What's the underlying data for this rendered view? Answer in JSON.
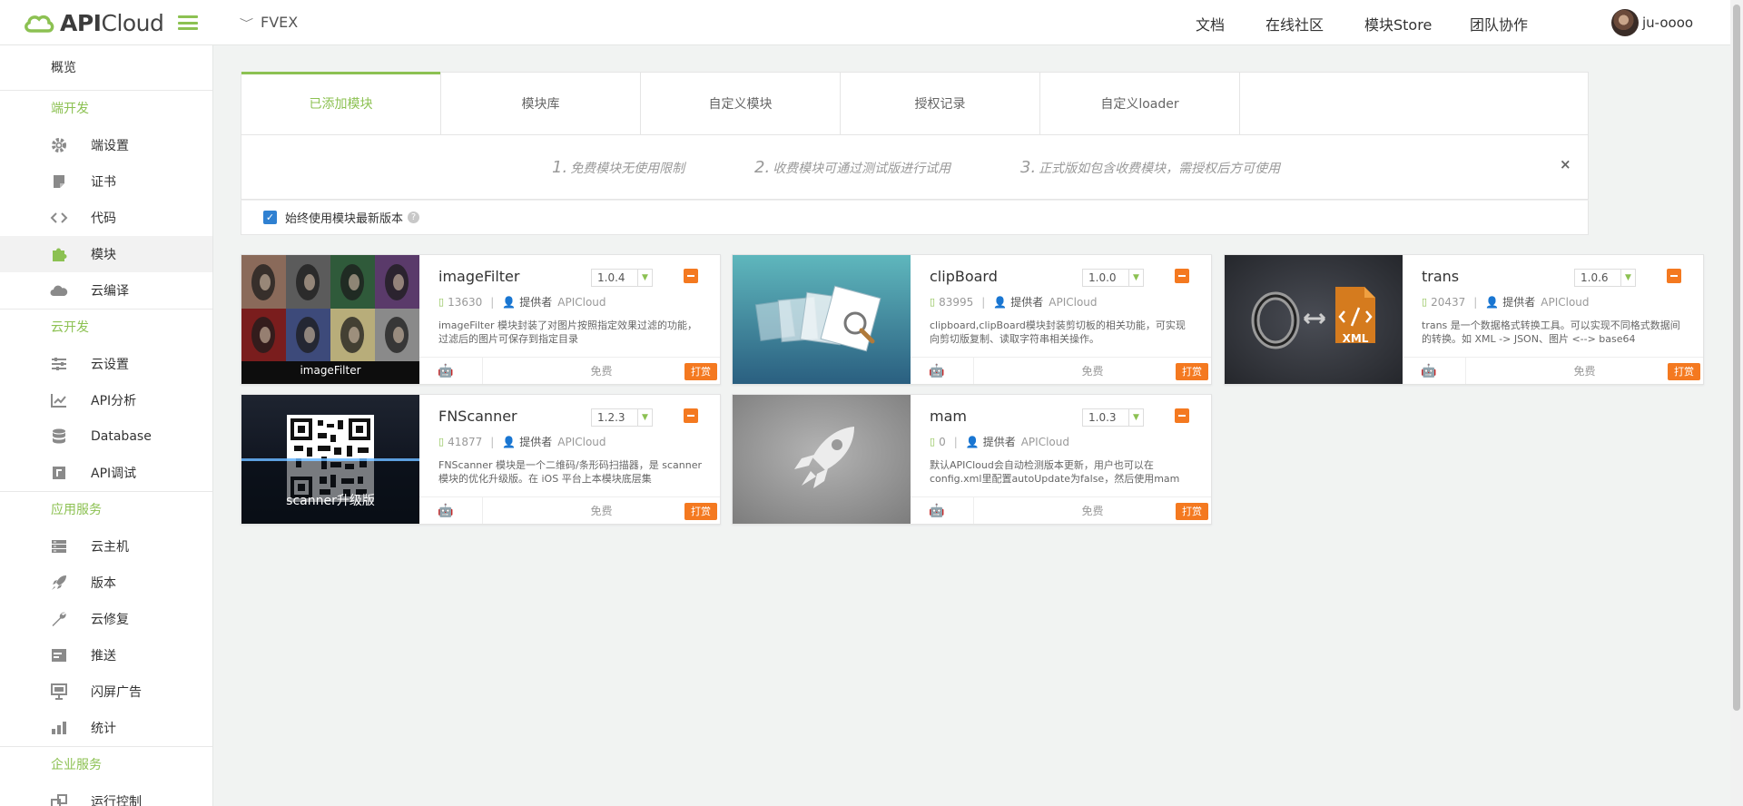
{
  "header": {
    "logo_text": "APICloud",
    "project": "FVEX",
    "nav": [
      "文档",
      "在线社区",
      "模块Store",
      "团队协作"
    ],
    "user": "ju-oooo"
  },
  "sidebar": {
    "overview": "概览",
    "sections": [
      {
        "title": "端开发",
        "items": [
          {
            "label": "端设置",
            "icon": "gear-icon"
          },
          {
            "label": "证书",
            "icon": "certificate-icon"
          },
          {
            "label": "代码",
            "icon": "code-icon"
          },
          {
            "label": "模块",
            "icon": "puzzle-icon"
          },
          {
            "label": "云编译",
            "icon": "cloud-icon"
          }
        ]
      },
      {
        "title": "云开发",
        "items": [
          {
            "label": "云设置",
            "icon": "sliders-icon"
          },
          {
            "label": "API分析",
            "icon": "chart-line-icon"
          },
          {
            "label": "Database",
            "icon": "database-icon"
          },
          {
            "label": "API调试",
            "icon": "debug-icon"
          }
        ]
      },
      {
        "title": "应用服务",
        "items": [
          {
            "label": "云主机",
            "icon": "server-icon"
          },
          {
            "label": "版本",
            "icon": "rocket-icon"
          },
          {
            "label": "云修复",
            "icon": "wrench-icon"
          },
          {
            "label": "推送",
            "icon": "push-icon"
          },
          {
            "label": "闪屏广告",
            "icon": "ad-icon"
          },
          {
            "label": "统计",
            "icon": "bar-chart-icon"
          }
        ]
      },
      {
        "title": "企业服务",
        "items": [
          {
            "label": "运行控制",
            "icon": "control-icon"
          }
        ]
      }
    ]
  },
  "tabs": [
    "已添加模块",
    "模块库",
    "自定义模块",
    "授权记录",
    "自定义loader"
  ],
  "notice": {
    "items": [
      {
        "num": "1.",
        "text": "免费模块无使用限制"
      },
      {
        "num": "2.",
        "text": "收费模块可通过测试版进行试用"
      },
      {
        "num": "3.",
        "text": "正式版如包含收费模块，需授权后方可使用"
      }
    ],
    "close": "×"
  },
  "option": {
    "label": "始终使用模块最新版本",
    "help": "?"
  },
  "modules": [
    {
      "name": "imageFilter",
      "version": "1.0.4",
      "downloads": "13630",
      "provider_label": "提供者",
      "provider": "APICloud",
      "desc": "imageFilter 模块封装了对图片按照指定效果过滤的功能，过滤后的图片可保存到指定目录",
      "price": "免费",
      "reward": "打赏",
      "thumb_caption": "imageFilter"
    },
    {
      "name": "clipBoard",
      "version": "1.0.0",
      "downloads": "83995",
      "provider_label": "提供者",
      "provider": "APICloud",
      "desc": "clipboard,clipBoard模块封装剪切板的相关功能，可实现向剪切版复制、读取字符串相关操作。",
      "price": "免费",
      "reward": "打赏",
      "thumb_caption": ""
    },
    {
      "name": "trans",
      "version": "1.0.6",
      "downloads": "20437",
      "provider_label": "提供者",
      "provider": "APICloud",
      "desc": "trans 是一个数据格式转换工具。可以实现不同格式数据间的转换。如 XML -> JSON、图片 <--> base64",
      "price": "免费",
      "reward": "打赏",
      "thumb_caption": "XML"
    },
    {
      "name": "FNScanner",
      "version": "1.2.3",
      "downloads": "41877",
      "provider_label": "提供者",
      "provider": "APICloud",
      "desc": "FNScanner 模块是一个二维码/条形码扫描器，是 scanner 模块的优化升级版。在 iOS 平台上本模块底层集",
      "price": "免费",
      "reward": "打赏",
      "thumb_caption": "scanner升级版"
    },
    {
      "name": "mam",
      "version": "1.0.3",
      "downloads": "0",
      "provider_label": "提供者",
      "provider": "APICloud",
      "desc": "默认APICloud会自动检测版本更新，用户也可以在config.xml里配置autoUpdate为false，然后使用mam",
      "price": "免费",
      "reward": "打赏",
      "thumb_caption": ""
    }
  ],
  "colors": {
    "accent": "#8cc152",
    "orange": "#f47920",
    "checkbox": "#2f80d1"
  }
}
